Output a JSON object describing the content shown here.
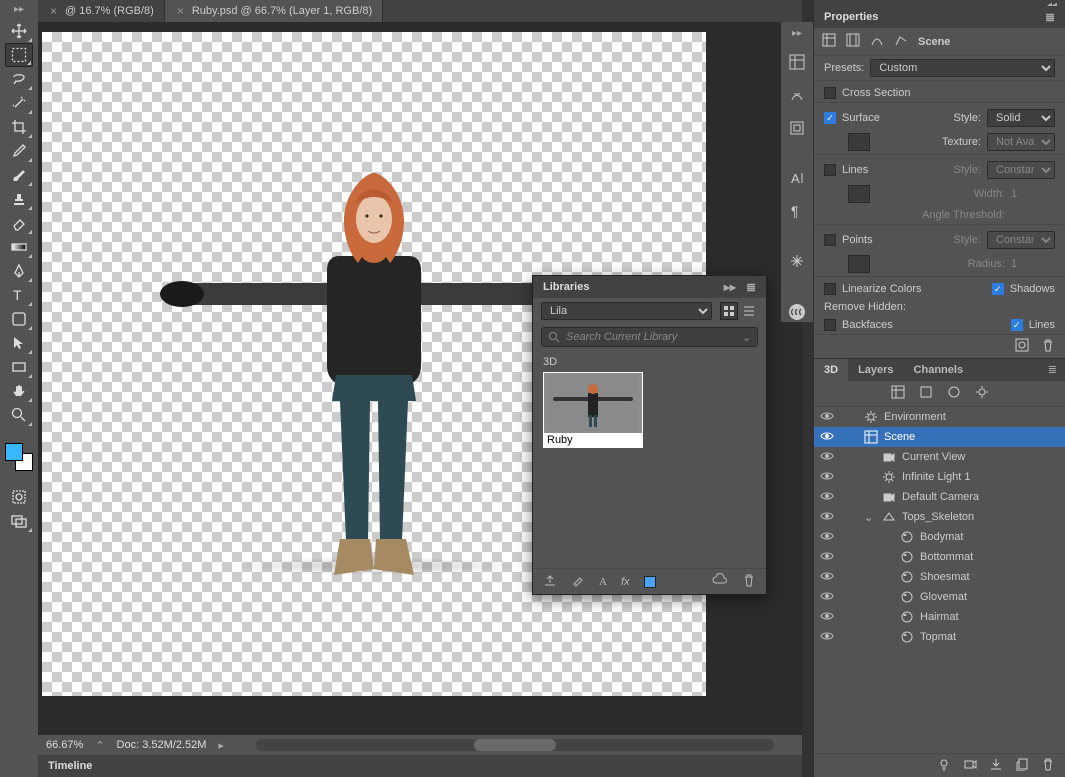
{
  "tabs": [
    {
      "label": "@ 16.7% (RGB/8)",
      "active": false
    },
    {
      "label": "Ruby.psd @ 66.7% (Layer 1, RGB/8)",
      "active": true
    }
  ],
  "status": {
    "zoom": "66.67%",
    "doc": "Doc: 3.52M/2.52M"
  },
  "timeline": {
    "title": "Timeline"
  },
  "properties": {
    "title": "Properties",
    "scene_label": "Scene",
    "presets_label": "Presets:",
    "preset_value": "Custom",
    "cross_section": {
      "label": "Cross Section",
      "on": false
    },
    "surface": {
      "label": "Surface",
      "on": true,
      "style_label": "Style:",
      "style_value": "Solid",
      "texture_label": "Texture:",
      "texture_value": "Not Avail..."
    },
    "lines": {
      "label": "Lines",
      "on": false,
      "style_label": "Style:",
      "style_value": "Constant",
      "width_label": "Width:",
      "width_value": "1",
      "angle_label": "Angle Threshold:"
    },
    "points": {
      "label": "Points",
      "on": false,
      "style_label": "Style:",
      "style_value": "Constant",
      "radius_label": "Radius:",
      "radius_value": "1"
    },
    "linearize": {
      "label": "Linearize Colors",
      "on": false
    },
    "shadows": {
      "label": "Shadows",
      "on": true
    },
    "remove_hidden_label": "Remove Hidden:",
    "backfaces": {
      "label": "Backfaces",
      "on": false
    },
    "rh_lines": {
      "label": "Lines",
      "on": true
    }
  },
  "panel3d": {
    "tabs": [
      "3D",
      "Layers",
      "Channels"
    ],
    "active_tab": 0,
    "items": [
      {
        "label": "Environment",
        "icon": "env",
        "indent": 0,
        "vis": true
      },
      {
        "label": "Scene",
        "icon": "scene",
        "indent": 0,
        "vis": true,
        "selected": true
      },
      {
        "label": "Current View",
        "icon": "camera",
        "indent": 1,
        "vis": true
      },
      {
        "label": "Infinite Light 1",
        "icon": "light",
        "indent": 1,
        "vis": true
      },
      {
        "label": "Default Camera",
        "icon": "camera",
        "indent": 1,
        "vis": true
      },
      {
        "label": "Tops_Skeleton",
        "icon": "mesh",
        "indent": 1,
        "vis": true,
        "expandable": true
      },
      {
        "label": "Bodymat",
        "icon": "mat",
        "indent": 2,
        "vis": true
      },
      {
        "label": "Bottommat",
        "icon": "mat",
        "indent": 2,
        "vis": true
      },
      {
        "label": "Shoesmat",
        "icon": "mat",
        "indent": 2,
        "vis": true
      },
      {
        "label": "Glovemat",
        "icon": "mat",
        "indent": 2,
        "vis": true
      },
      {
        "label": "Hairmat",
        "icon": "mat",
        "indent": 2,
        "vis": true
      },
      {
        "label": "Topmat",
        "icon": "mat",
        "indent": 2,
        "vis": true
      }
    ]
  },
  "libraries": {
    "title": "Libraries",
    "dropdown": "Lila",
    "search_placeholder": "Search Current Library",
    "category": "3D",
    "item_caption": "Ruby"
  }
}
